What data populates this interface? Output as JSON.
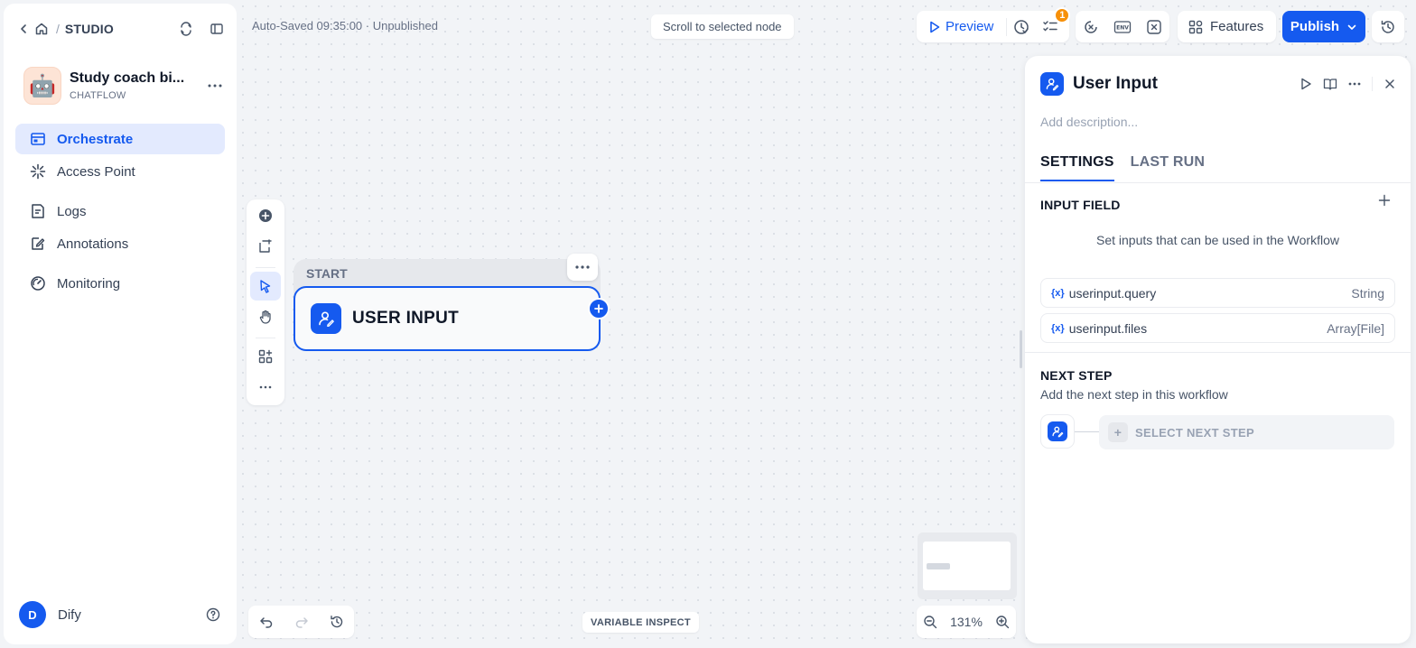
{
  "header": {
    "breadcrumb": "STUDIO",
    "auto_saved": "Auto-Saved 09:35:00 · Unpublished",
    "scroll_to_selected": "Scroll to selected node",
    "preview_label": "Preview",
    "checklist_badge": "1",
    "features_label": "Features",
    "publish_label": "Publish"
  },
  "app": {
    "name": "Study coach bi...",
    "type": "CHATFLOW",
    "icon": "robot-emoji"
  },
  "sidebar": {
    "items": [
      {
        "label": "Orchestrate",
        "icon": "orchestrate-icon",
        "active": true
      },
      {
        "label": "Access Point",
        "icon": "access-point-icon"
      },
      {
        "label": "Logs",
        "icon": "logs-icon"
      },
      {
        "label": "Annotations",
        "icon": "annotations-icon"
      },
      {
        "label": "Monitoring",
        "icon": "monitoring-icon"
      }
    ],
    "user": {
      "initial": "D",
      "name": "Dify"
    }
  },
  "canvas": {
    "node": {
      "header": "START",
      "title": "USER INPUT"
    },
    "variable_inspect": "VARIABLE INSPECT",
    "zoom": "131%"
  },
  "panel": {
    "title": "User Input",
    "description_placeholder": "Add description...",
    "tabs": [
      {
        "label": "SETTINGS",
        "active": true
      },
      {
        "label": "LAST RUN"
      }
    ],
    "input_field": {
      "title": "INPUT FIELD",
      "hint": "Set inputs that can be used in the Workflow",
      "variables": [
        {
          "name": "userinput.query",
          "type": "String"
        },
        {
          "name": "userinput.files",
          "type": "Array[File]"
        }
      ]
    },
    "next_step": {
      "title": "NEXT STEP",
      "hint": "Add the next step in this workflow",
      "select_label": "SELECT NEXT STEP"
    }
  },
  "colors": {
    "accent": "#155aef",
    "badge": "#f79009",
    "sidebar_active_bg": "#e3eafe"
  }
}
